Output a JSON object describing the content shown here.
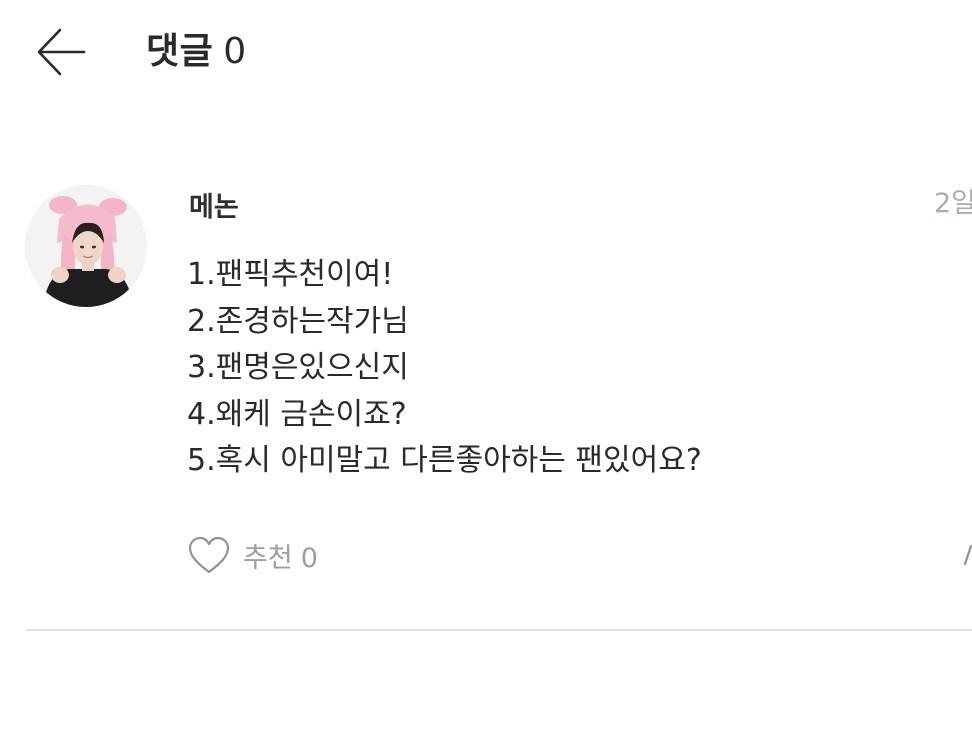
{
  "header": {
    "title": "댓글",
    "count": "0",
    "back_icon": "arrow-left-icon"
  },
  "comment": {
    "author": "메논",
    "timestamp": "2일",
    "lines": [
      "1.팬픽추천이여!",
      "2.존경하는작가님",
      "3.팬명은있으신지",
      "4.왜케 금손이죠?",
      "5.혹시 아미말고 다른좋아하는 팬있어요?"
    ],
    "like_label": "추천",
    "like_count": "0",
    "like_icon": "heart-outline-icon",
    "avatar_icon": "avatar-photo"
  },
  "colors": {
    "text_primary": "#2b2b2b",
    "text_muted": "#a9adb3",
    "divider": "#e2e4e7",
    "background": "#ffffff"
  }
}
